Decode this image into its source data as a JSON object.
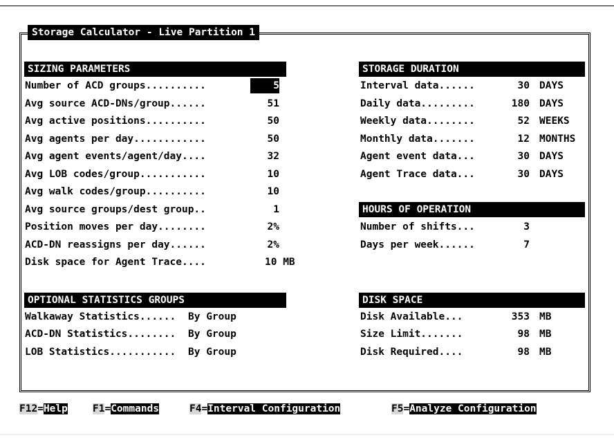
{
  "window": {
    "title": "Storage Calculator - Live Partition 1"
  },
  "sizing": {
    "header": "SIZING PARAMETERS",
    "rows": [
      {
        "label": "Number of ACD groups..........",
        "value": "5"
      },
      {
        "label": "Avg source ACD-DNs/group......",
        "value": "51"
      },
      {
        "label": "Avg active positions..........",
        "value": "50"
      },
      {
        "label": "Avg agents per day............",
        "value": "50"
      },
      {
        "label": "Avg agent events/agent/day....",
        "value": "32"
      },
      {
        "label": "Avg LOB codes/group...........",
        "value": "10"
      },
      {
        "label": "Avg walk codes/group..........",
        "value": "10"
      },
      {
        "label": "Avg source groups/dest group..",
        "value": "1"
      },
      {
        "label": "Position moves per day........",
        "value": "2%"
      },
      {
        "label": "ACD-DN reassigns per day......",
        "value": "2%"
      },
      {
        "label": "Disk space for Agent Trace....",
        "value": "10 MB"
      }
    ]
  },
  "optional": {
    "header": "OPTIONAL STATISTICS GROUPS",
    "rows": [
      {
        "label": "Walkaway Statistics......",
        "value": "By Group"
      },
      {
        "label": "ACD-DN Statistics........",
        "value": "By Group"
      },
      {
        "label": "LOB Statistics...........",
        "value": "By Group"
      }
    ]
  },
  "duration": {
    "header": "STORAGE DURATION",
    "rows": [
      {
        "label": "Interval data......",
        "value": "30",
        "unit": "DAYS"
      },
      {
        "label": "Daily data.........",
        "value": "180",
        "unit": "DAYS"
      },
      {
        "label": "Weekly data........",
        "value": "52",
        "unit": "WEEKS"
      },
      {
        "label": "Monthly data.......",
        "value": "12",
        "unit": "MONTHS"
      },
      {
        "label": "Agent event data...",
        "value": "30",
        "unit": "DAYS"
      },
      {
        "label": "Agent Trace data...",
        "value": "30",
        "unit": "DAYS"
      }
    ]
  },
  "hours": {
    "header": "HOURS OF OPERATION",
    "rows": [
      {
        "label": "Number of shifts...",
        "value": "3"
      },
      {
        "label": "Days per week......",
        "value": "7"
      }
    ]
  },
  "disk": {
    "header": "DISK SPACE",
    "rows": [
      {
        "label": "Disk Available...",
        "value": "353",
        "unit": "MB"
      },
      {
        "label": "Size Limit.......",
        "value": "98",
        "unit": "MB"
      },
      {
        "label": "Disk Required....",
        "value": "98",
        "unit": "MB"
      }
    ]
  },
  "fkeys": [
    {
      "key": "F12",
      "label": "Help"
    },
    {
      "key": "F1",
      "label": "Commands"
    },
    {
      "key": "F4",
      "label": "Interval Configuration"
    },
    {
      "key": "F5",
      "label": "Analyze Configuration"
    }
  ]
}
